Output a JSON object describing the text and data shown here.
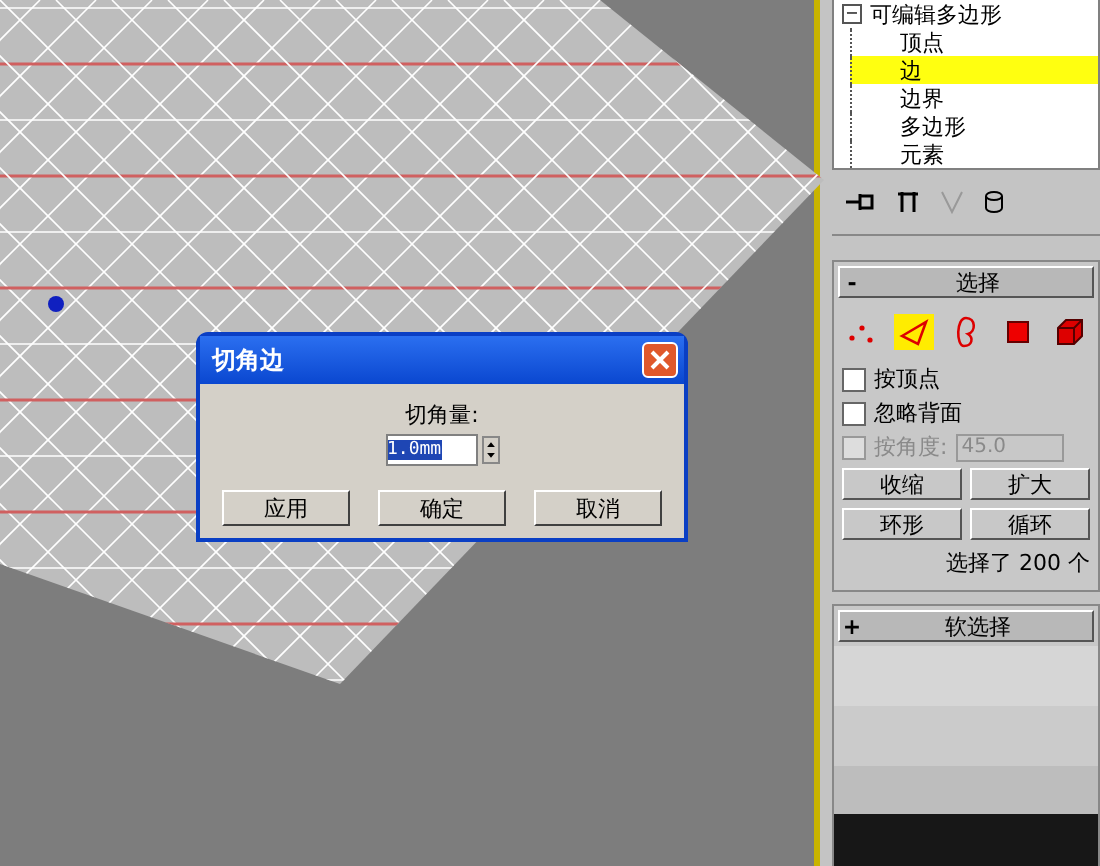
{
  "tree": {
    "toggle": "−",
    "root": "可编辑多边形",
    "items": [
      {
        "label": "顶点",
        "selected": false
      },
      {
        "label": "边",
        "selected": true
      },
      {
        "label": "边界",
        "selected": false
      },
      {
        "label": "多边形",
        "selected": false
      },
      {
        "label": "元素",
        "selected": false
      }
    ]
  },
  "dialog": {
    "title": "切角边",
    "field_label": "切角量:",
    "value": "1.0mm",
    "buttons": [
      "应用",
      "确定",
      "取消"
    ]
  },
  "selection": {
    "toggle": "-",
    "title": "选择",
    "modes": [
      {
        "kind": "vertex",
        "selected": false
      },
      {
        "kind": "edge",
        "selected": true
      },
      {
        "kind": "border",
        "selected": false
      },
      {
        "kind": "polygon",
        "selected": false
      },
      {
        "kind": "element",
        "selected": false
      }
    ],
    "options": [
      {
        "label": "按顶点",
        "checked": false,
        "disabled": false
      },
      {
        "label": "忽略背面",
        "checked": false,
        "disabled": false
      },
      {
        "label": "按角度:",
        "checked": false,
        "disabled": true,
        "value": "45.0"
      }
    ],
    "buttons": [
      [
        "收缩",
        "扩大"
      ],
      [
        "环形",
        "循环"
      ]
    ],
    "status": "选择了 200 个"
  },
  "soft_selection": {
    "toggle": "+",
    "title": "软选择"
  }
}
